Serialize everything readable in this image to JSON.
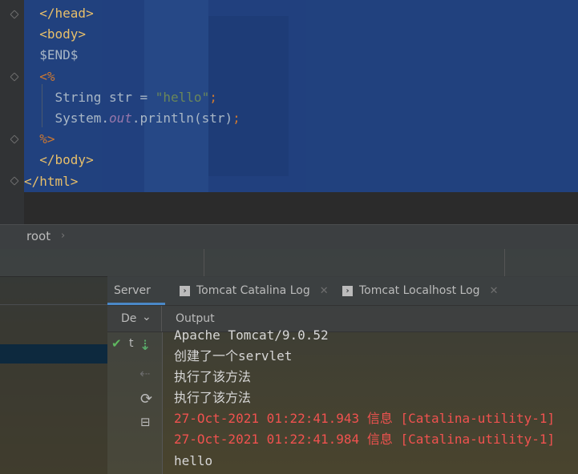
{
  "editor": {
    "lines": [
      {
        "indent": "  ",
        "tokens": [
          {
            "t": "</head>",
            "c": "tag"
          }
        ]
      },
      {
        "indent": "  ",
        "tokens": [
          {
            "t": "<body>",
            "c": "tag"
          }
        ]
      },
      {
        "indent": "  ",
        "tokens": [
          {
            "t": "$END$",
            "c": "plain"
          }
        ]
      },
      {
        "indent": "  ",
        "tokens": [
          {
            "t": "<%",
            "c": "jsp"
          }
        ]
      },
      {
        "indent": "    ",
        "tokens": [
          {
            "t": "String str = ",
            "c": "plain"
          },
          {
            "t": "\"hello\"",
            "c": "str"
          },
          {
            "t": ";",
            "c": "jsp"
          }
        ]
      },
      {
        "indent": "    ",
        "tokens": [
          {
            "t": "System.",
            "c": "plain"
          },
          {
            "t": "out",
            "c": "fld"
          },
          {
            "t": ".println(str)",
            "c": "plain"
          },
          {
            "t": ";",
            "c": "jsp"
          }
        ]
      },
      {
        "indent": "  ",
        "tokens": [
          {
            "t": "%>",
            "c": "jsp"
          }
        ]
      },
      {
        "indent": "  ",
        "tokens": [
          {
            "t": "</body>",
            "c": "tag"
          }
        ]
      },
      {
        "indent": "",
        "tokens": [
          {
            "t": "</html>",
            "c": "tag"
          }
        ]
      }
    ]
  },
  "breadcrumb": {
    "item": "root",
    "chevron": "›"
  },
  "services": {
    "tabs": [
      {
        "id": "server",
        "label": "Server",
        "active": true
      },
      {
        "id": "catalina",
        "label": "Tomcat Catalina Log",
        "icon": "console-icon",
        "closable": true
      },
      {
        "id": "localhost",
        "label": "Tomcat Localhost Log",
        "icon": "console-icon",
        "closable": true
      }
    ],
    "deployment_header": "De",
    "deployment_chevron": "⌄",
    "output_header": "Output",
    "deployment_item": "t",
    "toolbar_icons": [
      "update-icon",
      "undeploy-icon",
      "refresh-icon",
      "deploy-icon"
    ]
  },
  "output_lines": [
    {
      "text": "Apache Tomcat/9.0.52",
      "type": "normal"
    },
    {
      "text": "创建了一个servlet",
      "type": "normal"
    },
    {
      "text": "执行了该方法",
      "type": "normal"
    },
    {
      "text": "执行了该方法",
      "type": "normal"
    },
    {
      "text": "27-Oct-2021 01:22:41.943 信息 [Catalina-utility-1]",
      "type": "err"
    },
    {
      "text": "27-Oct-2021 01:22:41.984 信息 [Catalina-utility-1]",
      "type": "err"
    },
    {
      "text": "hello",
      "type": "normal"
    }
  ],
  "colors": {
    "selection": "#214283",
    "tag": "#e8bf6a",
    "jsp_delim": "#cc7832",
    "string": "#6a8759",
    "error_text": "#f0524f",
    "accent_tab": "#4a88c7"
  }
}
